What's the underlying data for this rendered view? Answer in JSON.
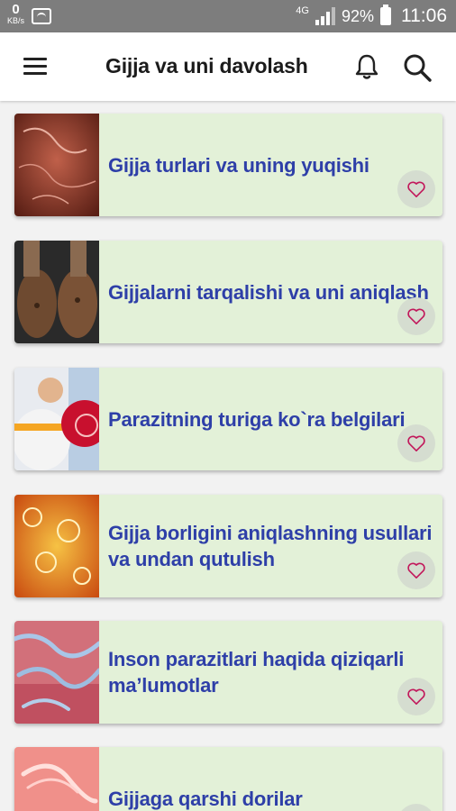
{
  "status_bar": {
    "speed_value": "0",
    "speed_unit": "KB/s",
    "network": "4G",
    "battery": "92%",
    "time": "11:06"
  },
  "app_bar": {
    "title": "Gijja va uni davolash",
    "menu_icon": "hamburger-menu-icon",
    "bell_icon": "bell-icon",
    "search_icon": "search-icon"
  },
  "articles": [
    {
      "title": "Gijja turlari va uning yuqishi",
      "thumbnail": "red-tissue-worms",
      "fav_icon": "heart-outline-icon"
    },
    {
      "title": "Gijjalarni tarqalishi va uni aniqlash",
      "thumbnail": "dirty-hands",
      "fav_icon": "heart-outline-icon"
    },
    {
      "title": "Parazitning turiga ko`ra belgilari",
      "thumbnail": "person-stomach-ache",
      "fav_icon": "heart-outline-icon"
    },
    {
      "title": "Gijja borligini aniqlashning usullari va undan qutulish",
      "thumbnail": "orange-microscope-parasites",
      "fav_icon": "heart-outline-icon"
    },
    {
      "title": "Inson parazitlari haqida qiziqarli ma’lumotlar",
      "thumbnail": "blue-worms-pink-tissue",
      "fav_icon": "heart-outline-icon"
    },
    {
      "title": "Gijjaga qarshi dorilar",
      "thumbnail": "pink-worm",
      "fav_icon": "heart-outline-icon"
    }
  ],
  "colors": {
    "status_bar_bg": "#7d7d7d",
    "card_bg": "#e3f1d8",
    "title_text": "#2e3fa8",
    "heart_stroke": "#c2185b"
  }
}
